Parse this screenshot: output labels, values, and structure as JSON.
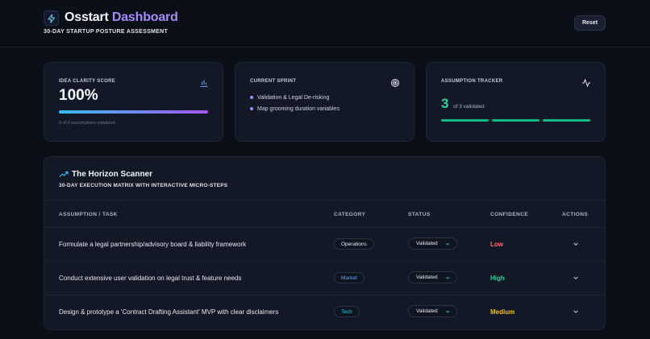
{
  "header": {
    "title_part1": "Osstart",
    "title_part2": "Dashboard",
    "subtitle": "30-DAY STARTUP POSTURE ASSESSMENT",
    "reset_label": "Reset"
  },
  "cards": {
    "idea_clarity": {
      "label": "IDEA CLARITY SCORE",
      "value": "100%",
      "progress_percent": 100,
      "caption": "3 of 3 assumptions validated",
      "icon": "bar-chart-icon"
    },
    "sprint": {
      "label": "CURRENT SPRINT",
      "items": [
        "Validation & Legal De-risking",
        "Map grooming duration variables"
      ],
      "icon": "target-icon"
    },
    "tracker": {
      "label": "ASSUMPTION TRACKER",
      "count": "3",
      "caption": "of 3 validated",
      "validated": 3,
      "total": 3,
      "icon": "activity-icon"
    }
  },
  "scanner": {
    "title": "The Horizon Scanner",
    "subtitle": "30-DAY EXECUTION MATRIX WITH INTERACTIVE MICRO-STEPS",
    "icon": "trending-up-icon",
    "columns": [
      "ASSUMPTION / TASK",
      "CATEGORY",
      "STATUS",
      "CONFIDENCE",
      "ACTIONS"
    ],
    "rows": [
      {
        "task": "Formulate a legal partnership/advisory board & liability framework",
        "category": "Operations",
        "status": "Validated",
        "confidence": "Low"
      },
      {
        "task": "Conduct extensive user validation on legal trust & feature needs",
        "category": "Market",
        "status": "Validated",
        "confidence": "High"
      },
      {
        "task": "Design & prototype a 'Contract Drafting Assistant' MVP with clear disclaimers",
        "category": "Tech",
        "status": "Validated",
        "confidence": "Medium"
      }
    ]
  },
  "colors": {
    "accent": "#a78bfa",
    "success": "#10b981",
    "low": "#f87171",
    "high": "#34d399",
    "medium": "#fbbf24",
    "market": "#60a5fa",
    "tech": "#22d3ee",
    "operations": "#e6e9ef"
  }
}
